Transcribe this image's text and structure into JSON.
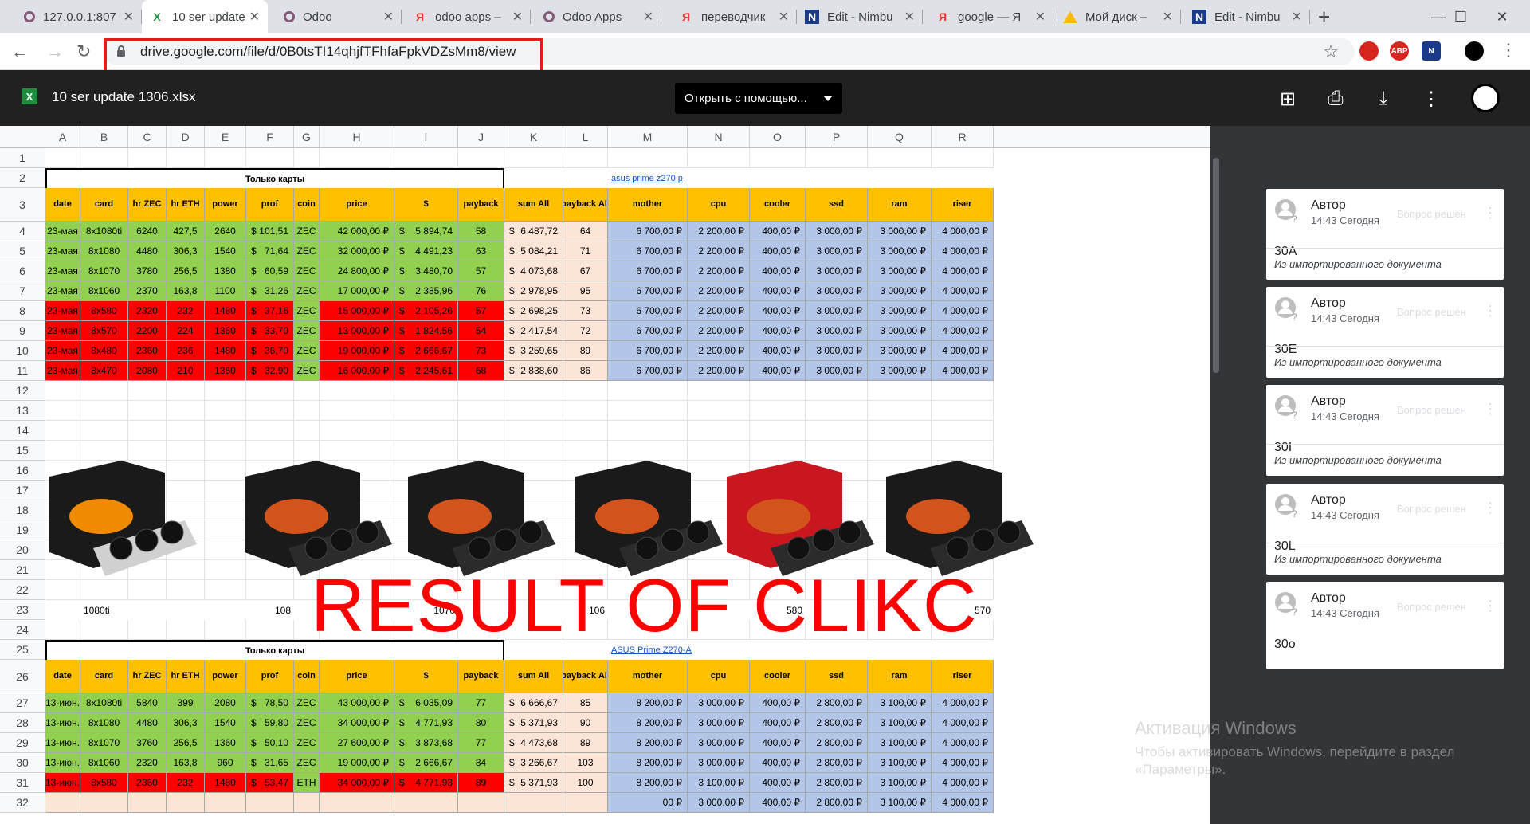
{
  "browser": {
    "tabs": [
      {
        "title": "127.0.0.1:807",
        "icon": "odoo-icon",
        "active": false
      },
      {
        "title": "10 ser update",
        "icon": "sheets-icon",
        "active": true
      },
      {
        "title": "Odoo",
        "icon": "odoo-icon",
        "active": false
      },
      {
        "title": "odoo apps –",
        "icon": "yandex-icon",
        "active": false
      },
      {
        "title": "Odoo Apps",
        "icon": "odoo-icon",
        "active": false
      },
      {
        "title": "переводчик",
        "icon": "yandex-icon",
        "active": false
      },
      {
        "title": "Edit - Nimbu",
        "icon": "nimbus-icon",
        "active": false
      },
      {
        "title": "google — Я",
        "icon": "yandex-icon",
        "active": false
      },
      {
        "title": "Мой диск –",
        "icon": "drive-icon",
        "active": false
      },
      {
        "title": "Edit - Nimbu",
        "icon": "nimbus-icon",
        "active": false
      }
    ],
    "url": "drive.google.com/file/d/0B0tsTI14qhjfTFhfaFpkVDZsMm8/view",
    "extensions": [
      "ABP",
      "N"
    ]
  },
  "viewer": {
    "filename": "10 ser update 1306.xlsx",
    "open_with": "Открыть с помощью...",
    "colors": {
      "header_bg": "#212121",
      "accent_red": "#e31b1b"
    }
  },
  "sheet": {
    "columns": [
      "A",
      "B",
      "C",
      "D",
      "E",
      "F",
      "G",
      "H",
      "I",
      "J",
      "K",
      "L",
      "M",
      "N",
      "O",
      "P",
      "Q",
      "R"
    ],
    "rows": [
      "1",
      "2",
      "3",
      "4",
      "5",
      "6",
      "7",
      "8",
      "9",
      "10",
      "11",
      "12",
      "13",
      "14",
      "15",
      "16",
      "17",
      "18",
      "19",
      "20",
      "21",
      "22",
      "23",
      "24",
      "25",
      "26",
      "27",
      "28",
      "29",
      "30",
      "31",
      "32"
    ],
    "section1": {
      "title": "Только карты",
      "link": "asus prime z270 p",
      "headers": [
        "date",
        "card",
        "hr ZEC",
        "hr ETH",
        "power",
        "prof",
        "coin",
        "price",
        "$",
        "payback",
        "sum All",
        "payback All",
        "mother",
        "cpu",
        "cooler",
        "ssd",
        "ram",
        "riser"
      ],
      "data": [
        {
          "color": "g",
          "cells": [
            "23-мая",
            "8x1080ti",
            "6240",
            "427,5",
            "2640",
            "$",
            "101,51",
            "ZEC",
            "42 000,00 ₽",
            "$",
            "5 894,74",
            "58",
            "$",
            "6 487,72",
            "64",
            "6 700,00 ₽",
            "2 200,00 ₽",
            "400,00 ₽",
            "3 000,00 ₽",
            "3 000,00 ₽",
            "4 000,00 ₽"
          ]
        },
        {
          "color": "g",
          "cells": [
            "23-мая",
            "8x1080",
            "4480",
            "306,3",
            "1540",
            "$",
            "71,64",
            "ZEC",
            "32 000,00 ₽",
            "$",
            "4 491,23",
            "63",
            "$",
            "5 084,21",
            "71",
            "6 700,00 ₽",
            "2 200,00 ₽",
            "400,00 ₽",
            "3 000,00 ₽",
            "3 000,00 ₽",
            "4 000,00 ₽"
          ]
        },
        {
          "color": "g",
          "cells": [
            "23-мая",
            "8x1070",
            "3780",
            "256,5",
            "1380",
            "$",
            "60,59",
            "ZEC",
            "24 800,00 ₽",
            "$",
            "3 480,70",
            "57",
            "$",
            "4 073,68",
            "67",
            "6 700,00 ₽",
            "2 200,00 ₽",
            "400,00 ₽",
            "3 000,00 ₽",
            "3 000,00 ₽",
            "4 000,00 ₽"
          ]
        },
        {
          "color": "g",
          "cells": [
            "23-мая",
            "8x1060",
            "2370",
            "163,8",
            "1100",
            "$",
            "31,26",
            "ZEC",
            "17 000,00 ₽",
            "$",
            "2 385,96",
            "76",
            "$",
            "2 978,95",
            "95",
            "6 700,00 ₽",
            "2 200,00 ₽",
            "400,00 ₽",
            "3 000,00 ₽",
            "3 000,00 ₽",
            "4 000,00 ₽"
          ]
        },
        {
          "color": "r",
          "cells": [
            "23-мая",
            "8x580",
            "2320",
            "232",
            "1480",
            "$",
            "37,16",
            "ZEC",
            "15 000,00 ₽",
            "$",
            "2 105,26",
            "57",
            "$",
            "2 698,25",
            "73",
            "6 700,00 ₽",
            "2 200,00 ₽",
            "400,00 ₽",
            "3 000,00 ₽",
            "3 000,00 ₽",
            "4 000,00 ₽"
          ]
        },
        {
          "color": "r",
          "cells": [
            "23-мая",
            "8x570",
            "2200",
            "224",
            "1360",
            "$",
            "33,70",
            "ZEC",
            "13 000,00 ₽",
            "$",
            "1 824,56",
            "54",
            "$",
            "2 417,54",
            "72",
            "6 700,00 ₽",
            "2 200,00 ₽",
            "400,00 ₽",
            "3 000,00 ₽",
            "3 000,00 ₽",
            "4 000,00 ₽"
          ]
        },
        {
          "color": "r",
          "cells": [
            "23-мая",
            "8x480",
            "2360",
            "236",
            "1480",
            "$",
            "36,70",
            "ZEC",
            "19 000,00 ₽",
            "$",
            "2 666,67",
            "73",
            "$",
            "3 259,65",
            "89",
            "6 700,00 ₽",
            "2 200,00 ₽",
            "400,00 ₽",
            "3 000,00 ₽",
            "3 000,00 ₽",
            "4 000,00 ₽"
          ]
        },
        {
          "color": "r",
          "cells": [
            "23-мая",
            "8x470",
            "2080",
            "210",
            "1360",
            "$",
            "32,90",
            "ZEC",
            "16 000,00 ₽",
            "$",
            "2 245,61",
            "68",
            "$",
            "2 838,60",
            "86",
            "6 700,00 ₽",
            "2 200,00 ₽",
            "400,00 ₽",
            "3 000,00 ₽",
            "3 000,00 ₽",
            "4 000,00 ₽"
          ]
        }
      ]
    },
    "gpu_labels": [
      "1080ti",
      "108",
      "1070",
      "106",
      "580",
      "570"
    ],
    "section2": {
      "title": "Только карты",
      "link": "ASUS Prime Z270-A",
      "data": [
        {
          "color": "g",
          "cells": [
            "13-июн.",
            "8x1080ti",
            "5840",
            "399",
            "2080",
            "$",
            "78,50",
            "ZEC",
            "43 000,00 ₽",
            "$",
            "6 035,09",
            "77",
            "$",
            "6 666,67",
            "85",
            "8 200,00 ₽",
            "3 000,00 ₽",
            "400,00 ₽",
            "2 800,00 ₽",
            "3 100,00 ₽",
            "4 000,00 ₽"
          ]
        },
        {
          "color": "g",
          "cells": [
            "13-июн.",
            "8x1080",
            "4480",
            "306,3",
            "1540",
            "$",
            "59,80",
            "ZEC",
            "34 000,00 ₽",
            "$",
            "4 771,93",
            "80",
            "$",
            "5 371,93",
            "90",
            "8 200,00 ₽",
            "3 000,00 ₽",
            "400,00 ₽",
            "2 800,00 ₽",
            "3 100,00 ₽",
            "4 000,00 ₽"
          ]
        },
        {
          "color": "g",
          "cells": [
            "13-июн.",
            "8x1070",
            "3760",
            "256,5",
            "1360",
            "$",
            "50,10",
            "ZEC",
            "27 600,00 ₽",
            "$",
            "3 873,68",
            "77",
            "$",
            "4 473,68",
            "89",
            "8 200,00 ₽",
            "3 000,00 ₽",
            "400,00 ₽",
            "2 800,00 ₽",
            "3 100,00 ₽",
            "4 000,00 ₽"
          ]
        },
        {
          "color": "g",
          "cells": [
            "13-июн.",
            "8x1060",
            "2320",
            "163,8",
            "960",
            "$",
            "31,65",
            "ZEC",
            "19 000,00 ₽",
            "$",
            "2 666,67",
            "84",
            "$",
            "3 266,67",
            "103",
            "8 200,00 ₽",
            "3 000,00 ₽",
            "400,00 ₽",
            "2 800,00 ₽",
            "3 100,00 ₽",
            "4 000,00 ₽"
          ]
        },
        {
          "color": "r",
          "cells": [
            "13-июн.",
            "8x580",
            "2360",
            "232",
            "1480",
            "$",
            "53,47",
            "ETH",
            "34 000,00 ₽",
            "$",
            "4 771,93",
            "89",
            "$",
            "5 371,93",
            "100",
            "8 200,00 ₽",
            "3 100,00 ₽",
            "400,00 ₽",
            "2 800,00 ₽",
            "3 100,00 ₽",
            "4 000,00 ₽"
          ]
        },
        {
          "color": "r",
          "cells": [
            "",
            "",
            "",
            "",
            "",
            "",
            "",
            "",
            "",
            "",
            "",
            "",
            "",
            "",
            "",
            "00 ₽",
            "3 000,00 ₽",
            "400,00 ₽",
            "2 800,00 ₽",
            "3 100,00 ₽",
            "4 000,00 ₽"
          ]
        }
      ]
    }
  },
  "overlay_text": "RESULT OF CLIKC",
  "comments": [
    {
      "author": "Автор",
      "time": "14:43 Сегодня",
      "resolve": "Вопрос решен",
      "body": "30A",
      "footer": "Из импортированного документа"
    },
    {
      "author": "Автор",
      "time": "14:43 Сегодня",
      "resolve": "Вопрос решен",
      "body": "30E",
      "footer": "Из импортированного документа"
    },
    {
      "author": "Автор",
      "time": "14:43 Сегодня",
      "resolve": "Вопрос решен",
      "body": "30I",
      "footer": "Из импортированного документа"
    },
    {
      "author": "Автор",
      "time": "14:43 Сегодня",
      "resolve": "Вопрос решен",
      "body": "30L",
      "footer": "Из импортированного документа"
    },
    {
      "author": "Автор",
      "time": "14:43 Сегодня",
      "resolve": "Вопрос решен",
      "body": "30o",
      "footer": ""
    }
  ],
  "activation": {
    "line1": "Активация Windows",
    "line2": "Чтобы активировать Windows, перейдите в раздел «Параметры»."
  }
}
